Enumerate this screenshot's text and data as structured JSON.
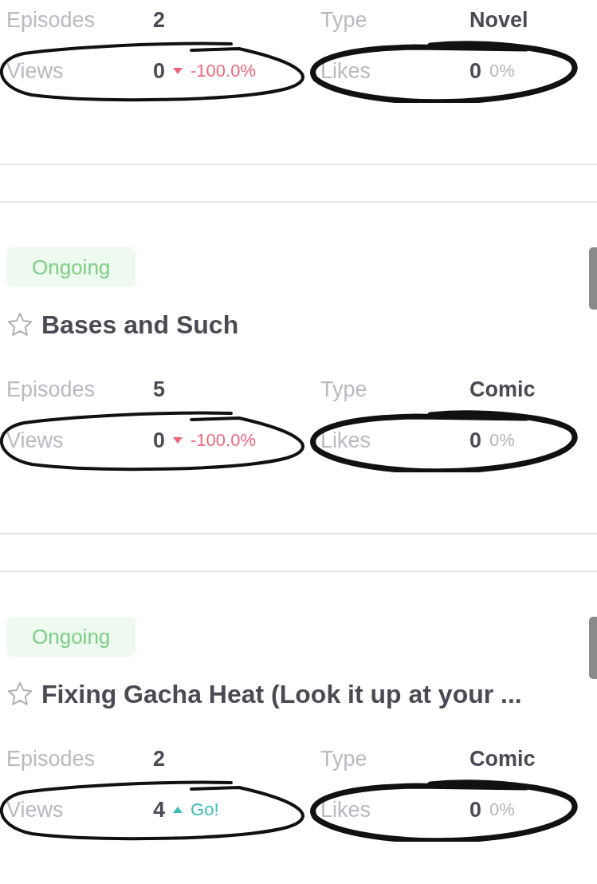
{
  "cards": [
    {
      "episodes_label": "Episodes",
      "episodes": "2",
      "type_label": "Type",
      "type": "Novel",
      "views_label": "Views",
      "views": "0",
      "views_change": {
        "kind": "down",
        "text": "-100.0%"
      },
      "likes_label": "Likes",
      "likes": "0",
      "likes_change": {
        "kind": "flat",
        "text": "0%"
      }
    },
    {
      "status": "Ongoing",
      "favorite": false,
      "title": "Bases and Such",
      "episodes_label": "Episodes",
      "episodes": "5",
      "type_label": "Type",
      "type": "Comic",
      "views_label": "Views",
      "views": "0",
      "views_change": {
        "kind": "down",
        "text": "-100.0%"
      },
      "likes_label": "Likes",
      "likes": "0",
      "likes_change": {
        "kind": "flat",
        "text": "0%"
      }
    },
    {
      "status": "Ongoing",
      "favorite": false,
      "title": "Fixing Gacha Heat (Look it up at your ...",
      "episodes_label": "Episodes",
      "episodes": "2",
      "type_label": "Type",
      "type": "Comic",
      "views_label": "Views",
      "views": "4",
      "views_change": {
        "kind": "up",
        "text": "Go!"
      },
      "likes_label": "Likes",
      "likes": "0",
      "likes_change": {
        "kind": "flat",
        "text": "0%"
      }
    }
  ]
}
